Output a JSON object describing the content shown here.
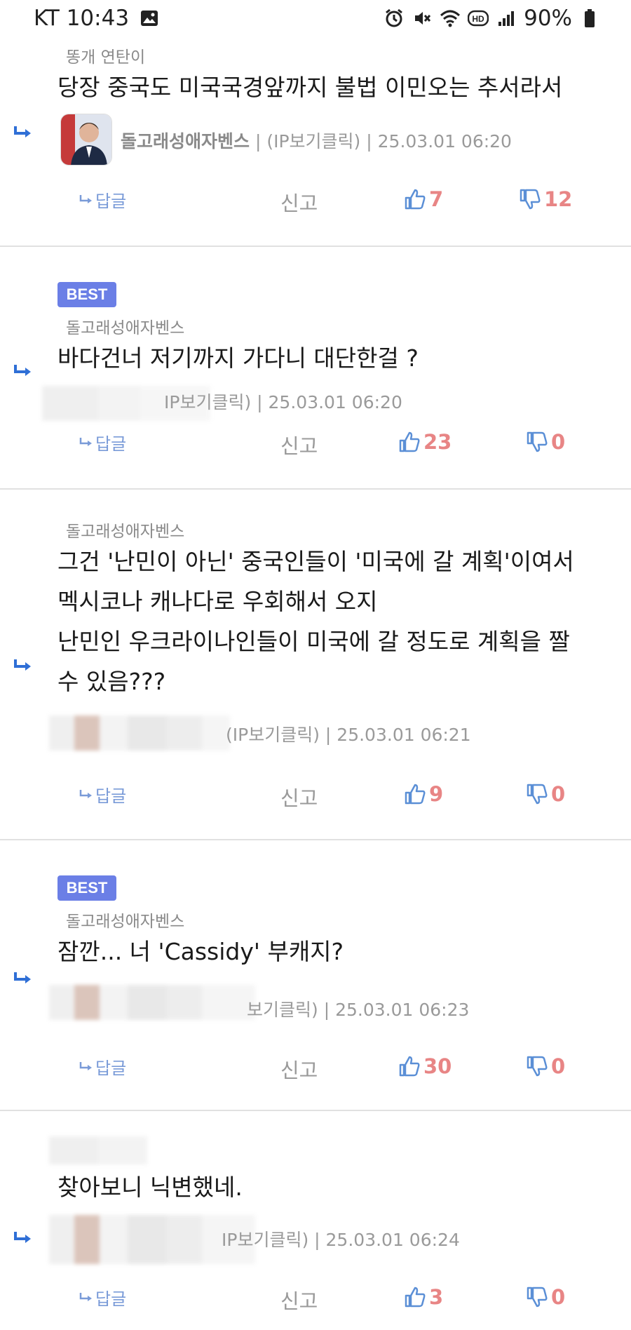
{
  "status_bar": {
    "carrier_time": "KT 10:43",
    "battery": "90%",
    "hd_label": "HD"
  },
  "comments": [
    {
      "nickname": "똥개 연탄이",
      "text": "당장 중국도 미국국경앞까지 불법 이민오는 추서라서",
      "author": "돌고래성애자벤스",
      "ip_label": "(IP보기클릭)",
      "timestamp": "25.03.01 06:20",
      "best": false,
      "reply_label": "답글",
      "report_label": "신고",
      "likes": "7",
      "dislikes": "12"
    },
    {
      "badge": "BEST",
      "nickname": "돌고래성애자벤스",
      "text": "바다건너 저기까지 가다니 대단한걸 ?",
      "meta_partial": "IP보기클릭)",
      "timestamp": "25.03.01 06:20",
      "best": true,
      "reply_label": "답글",
      "report_label": "신고",
      "likes": "23",
      "dislikes": "0"
    },
    {
      "nickname": "돌고래성애자벤스",
      "text": "그건 '난민이 아닌' 중국인들이 '미국에 갈 계획'이여서\n멕시코나 캐나다로 우회해서 오지\n난민인 우크라이나인들이 미국에 갈 정도로 계획을 짤\n수 있음???",
      "ip_label": "(IP보기클릭)",
      "timestamp": "25.03.01 06:21",
      "best": false,
      "reply_label": "답글",
      "report_label": "신고",
      "likes": "9",
      "dislikes": "0"
    },
    {
      "badge": "BEST",
      "nickname": "돌고래성애자벤스",
      "text": "잠깐... 너 'Cassidy' 부캐지?",
      "meta_partial": "보기클릭)",
      "timestamp": "25.03.01 06:23",
      "best": true,
      "reply_label": "답글",
      "report_label": "신고",
      "likes": "30",
      "dislikes": "0"
    },
    {
      "text": "찾아보니 닉변했네.",
      "meta_partial": "IP보기클릭)",
      "timestamp": "25.03.01 06:24",
      "best": false,
      "reply_label": "답글",
      "report_label": "신고",
      "likes": "3",
      "dislikes": "0"
    }
  ],
  "colors": {
    "best_badge": "#6b7fe6",
    "vote_count": "#e88585",
    "reply_link": "#7a9bd8",
    "reply_arrow": "#2f6fd6"
  }
}
